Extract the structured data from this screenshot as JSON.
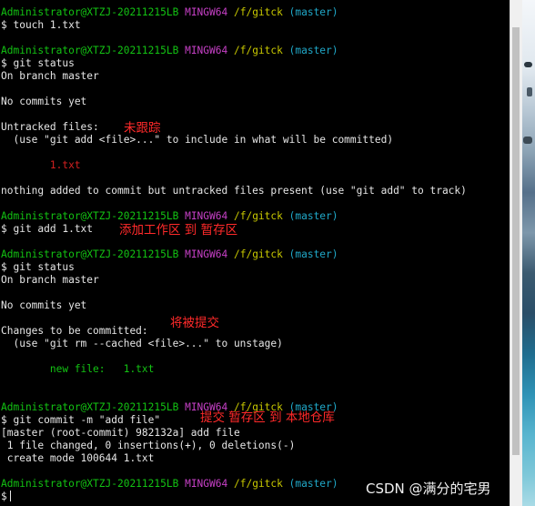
{
  "terminal": {
    "user": "Administrator@XTZJ-20211215LB",
    "shell": "MINGW64",
    "path": "/f/gitck",
    "branch": "(master)",
    "prompt_symbol": "$",
    "blocks": [
      {
        "command": "$ touch 1.txt",
        "output": []
      },
      {
        "command": "$ git status",
        "output": [
          "On branch master",
          "",
          "No commits yet",
          "",
          "Untracked files:",
          "  (use \"git add <file>...\" to include in what will be committed)",
          "",
          "        1.txt",
          "",
          "nothing added to commit but untracked files present (use \"git add\" to track)"
        ]
      },
      {
        "command": "$ git add 1.txt",
        "output": []
      },
      {
        "command": "$ git status",
        "output": [
          "On branch master",
          "",
          "No commits yet",
          "",
          "Changes to be committed:",
          "  (use \"git rm --cached <file>...\" to unstage)",
          "",
          "        new file:   1.txt",
          "",
          ""
        ]
      },
      {
        "command": "$ git commit -m \"add file\"",
        "output": [
          "[master (root-commit) 982132a] add file",
          " 1 file changed, 0 insertions(+), 0 deletions(-)",
          " create mode 100644 1.txt"
        ]
      }
    ]
  },
  "annotations": {
    "untracked": "未跟踪",
    "add": "添加工作区 到 暂存区",
    "staged": "将被提交",
    "commit": "提交 暂存区 到 本地仓库"
  },
  "watermark": "CSDN @满分的宅男",
  "colors": {
    "prompt_user": "#13c313",
    "prompt_shell": "#c640c6",
    "prompt_path": "#c8c800",
    "prompt_branch": "#20a8c8",
    "untracked_file": "#d42020",
    "staged_file": "#13c313",
    "annotation": "#ff2a2a"
  }
}
